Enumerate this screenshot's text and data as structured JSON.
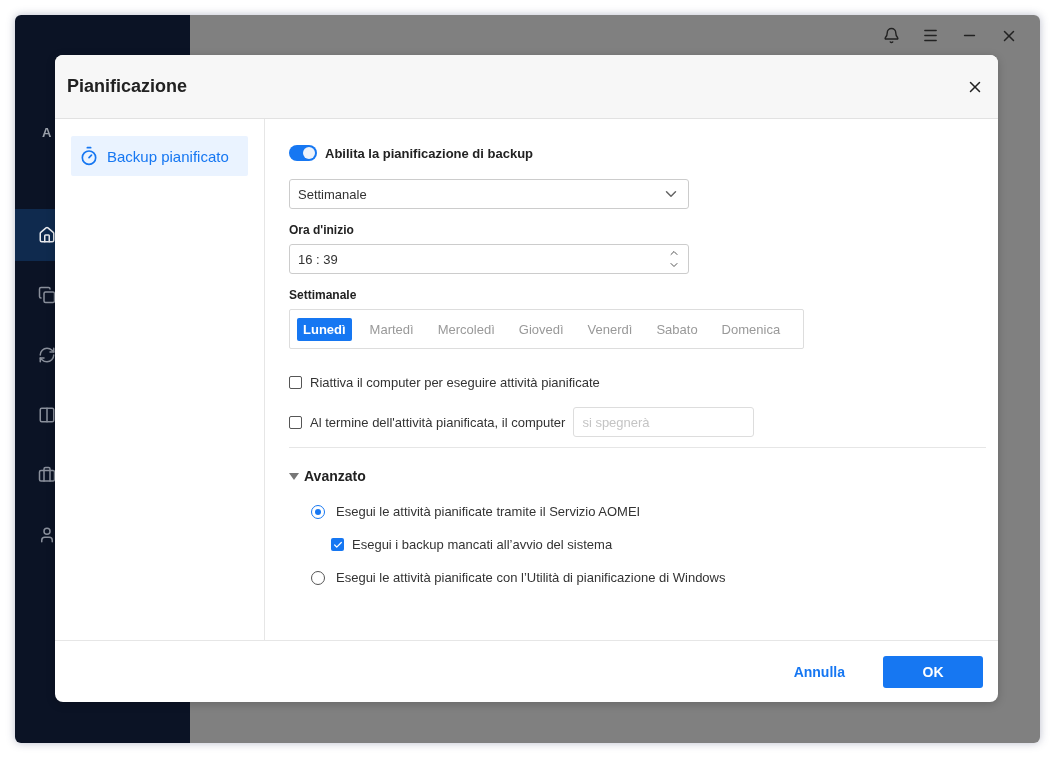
{
  "app": {
    "logo_text": "A",
    "nav_items": [
      {
        "selected": true
      },
      {
        "selected": false
      },
      {
        "selected": false
      },
      {
        "selected": false
      },
      {
        "selected": false
      },
      {
        "selected": false
      }
    ]
  },
  "dialog": {
    "title": "Pianificazione",
    "sidebar_items": [
      {
        "label": "Backup pianificato",
        "selected": true
      }
    ],
    "enable_toggle": {
      "label": "Abilita la pianificazione di backup",
      "on": true
    },
    "frequency_select": {
      "value": "Settimanale"
    },
    "start_time": {
      "label": "Ora d'inizio",
      "value": "16 : 39"
    },
    "weekly": {
      "label": "Settimanale",
      "days": [
        {
          "label": "Lunedì",
          "selected": true
        },
        {
          "label": "Martedì",
          "selected": false
        },
        {
          "label": "Mercoledì",
          "selected": false
        },
        {
          "label": "Giovedì",
          "selected": false
        },
        {
          "label": "Venerdì",
          "selected": false
        },
        {
          "label": "Sabato",
          "selected": false
        },
        {
          "label": "Domenica",
          "selected": false
        }
      ]
    },
    "options": [
      {
        "label": "Riattiva il computer per eseguire attività pianificate",
        "checked": false
      },
      {
        "label": "Al termine dell'attività pianificata, il computer",
        "checked": false,
        "placeholder": "si spegnerà"
      }
    ],
    "advanced": {
      "label": "Avanzato",
      "expanded": true,
      "options": [
        {
          "kind": "radio",
          "label": "Esegui le attività pianificate tramite il Servizio AOMEI",
          "selected": true
        },
        {
          "kind": "checkbox",
          "label": "Esegui i backup mancati all’avvio del sistema",
          "checked": true
        },
        {
          "kind": "radio",
          "label": "Esegui le attività pianificate con l’Utilità di pianificazione di Windows",
          "selected": false
        }
      ]
    },
    "buttons": {
      "cancel": "Annulla",
      "ok": "OK"
    }
  }
}
